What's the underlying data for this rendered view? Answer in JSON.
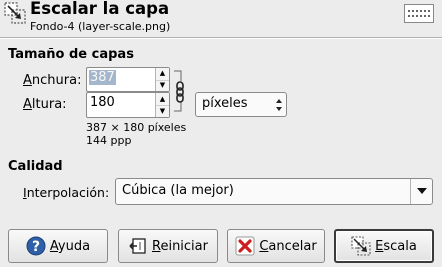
{
  "header": {
    "title": "Escalar la capa",
    "subtitle": "Fondo-4 (layer-scale.png)"
  },
  "layer_size": {
    "section_title": "Tamaño de capas",
    "width_label_u": "A",
    "width_label_rest": "nchura:",
    "width_value": "387",
    "height_label_u": "A",
    "height_label_rest": "ltura:",
    "height_value": "180",
    "unit_selected": "píxeles",
    "dimensions_text": "387 × 180 píxeles",
    "resolution_text": "144 ppp"
  },
  "quality": {
    "section_title": "Calidad",
    "interp_label_u": "I",
    "interp_label_rest": "nterpolación:",
    "interp_selected": "Cúbica (la mejor)"
  },
  "buttons": {
    "help_u": "A",
    "help_rest": "yuda",
    "reset_u": "R",
    "reset_rest": "einiciar",
    "cancel_u": "C",
    "cancel_rest": "ancelar",
    "scale_u": "E",
    "scale_rest": "scala"
  },
  "colors": {
    "background": "#ececec",
    "selection": "#a3b6cb",
    "help_blue": "#2f5fa8",
    "cancel_red": "#cc1f1f"
  }
}
